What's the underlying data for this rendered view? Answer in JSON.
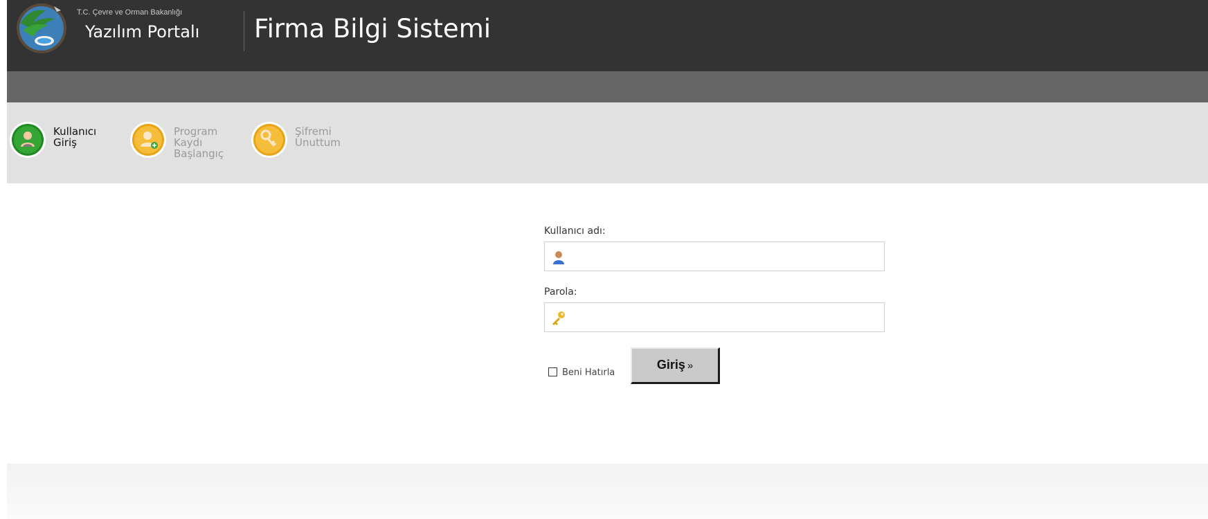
{
  "header": {
    "ministry": "T.C. Çevre ve Orman Bakanlığı",
    "portal_name": "Yazılım Portalı",
    "app_title": "Firma Bilgi Sistemi",
    "background": "#333333",
    "logo_icon": "ministry-tree-globe-logo"
  },
  "nav": {
    "items": [
      {
        "label": "Kullanıcı\nGiriş",
        "icon": "user-login-icon",
        "color": "#2e9a2e",
        "active": true
      },
      {
        "label": "Program\nKaydı\nBaşlangıç",
        "icon": "user-add-icon",
        "color": "#f2b01e",
        "active": false
      },
      {
        "label": "Şifremi\nUnuttum",
        "icon": "key-icon",
        "color": "#f2b01e",
        "active": false
      }
    ]
  },
  "login": {
    "username_label": "Kullanıcı adı:",
    "username_value": "",
    "password_label": "Parola:",
    "password_value": "",
    "remember_label": "Beni Hatırla",
    "remember_checked": false,
    "submit_label": "Giriş",
    "submit_suffix": "»"
  }
}
